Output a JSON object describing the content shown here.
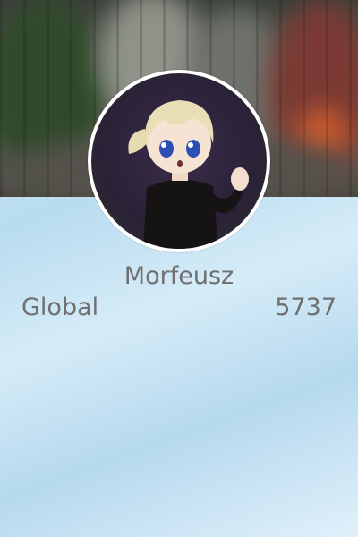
{
  "profile": {
    "name": "Morfeusz",
    "stat_label": "Global",
    "stat_value": "5737"
  },
  "colors": {
    "text": "#6f6f6f",
    "avatar_border": "#ffffff",
    "background": "#cfe6f5"
  }
}
